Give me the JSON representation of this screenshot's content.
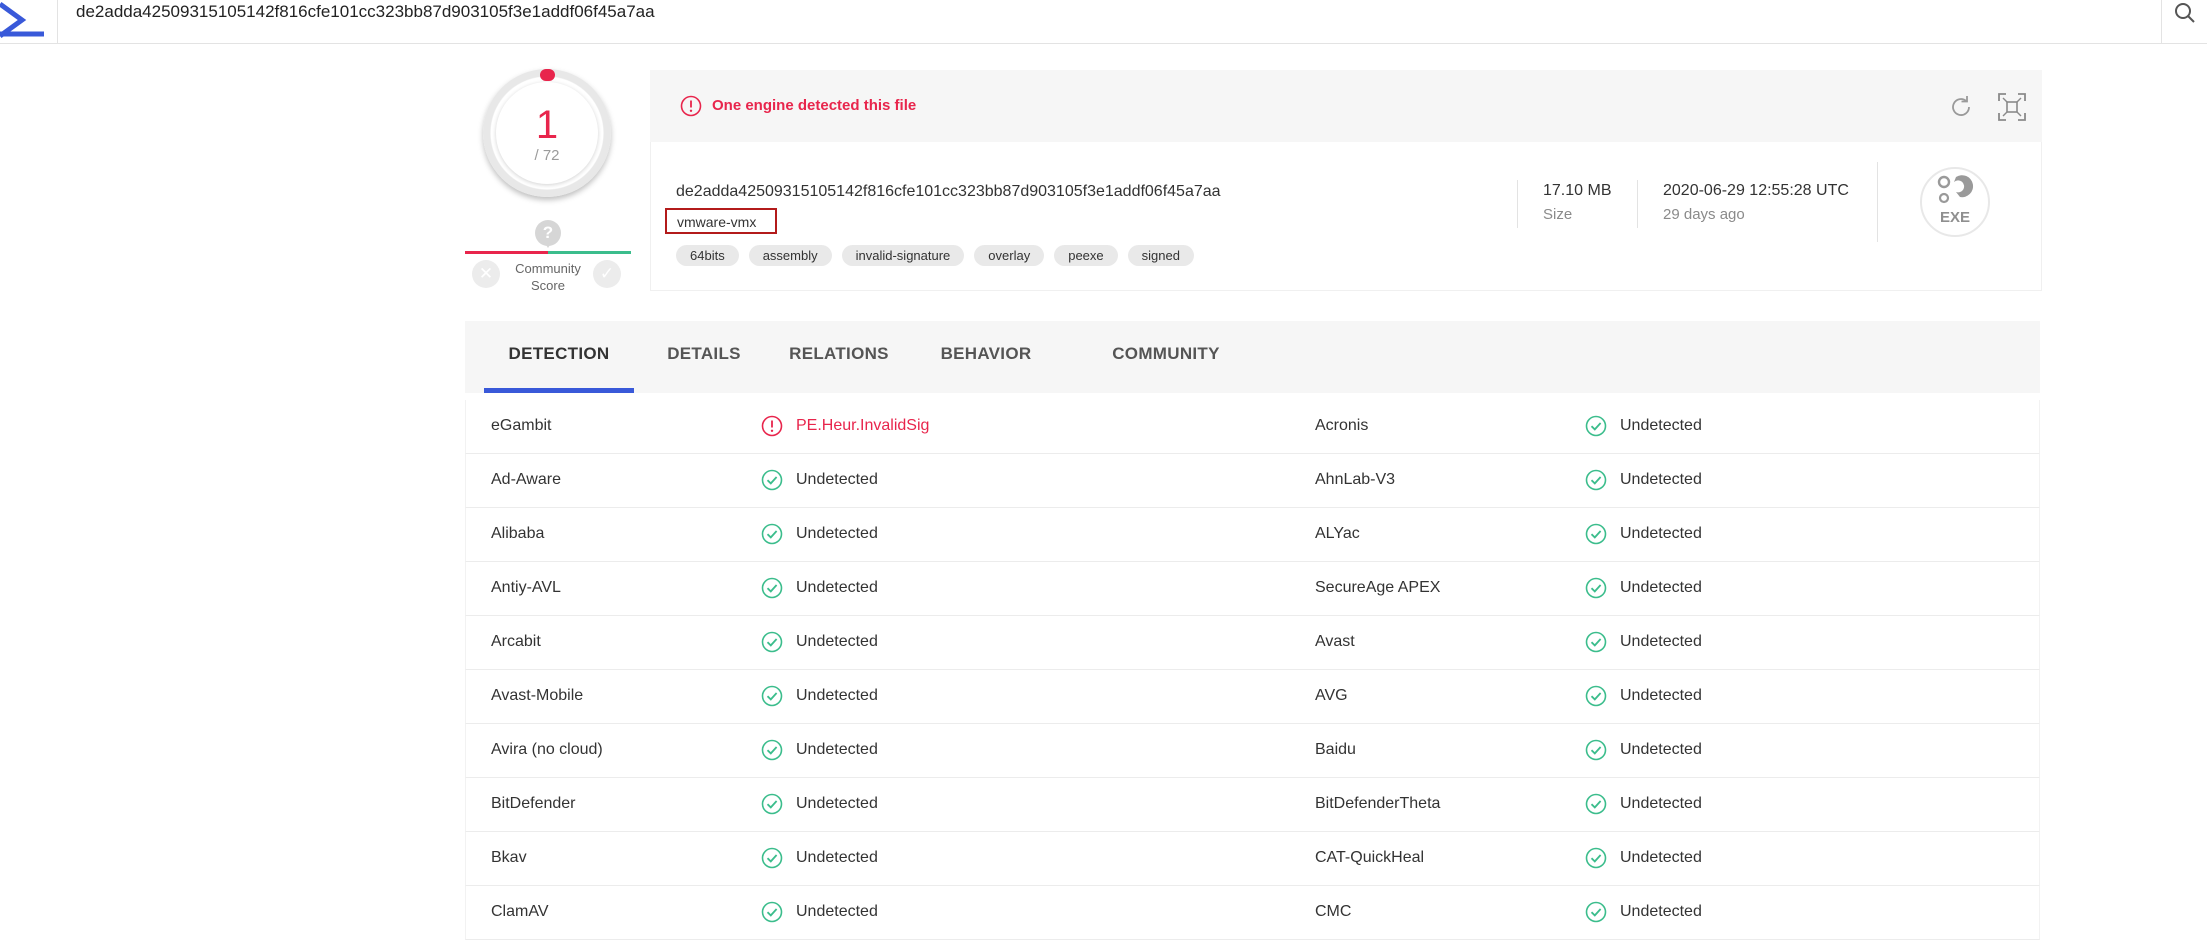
{
  "search": {
    "query": "de2adda42509315105142f816cfe101cc323bb87d903105f3e1addf06f45a7aa"
  },
  "score": {
    "positives": "1",
    "total": "/ 72"
  },
  "community": {
    "question": "?",
    "label_line1": "Community",
    "label_line2": "Score"
  },
  "summary": {
    "alert": "One engine detected this file",
    "hash": "de2adda42509315105142f816cfe101cc323bb87d903105f3e1addf06f45a7aa",
    "file_name": "vmware-vmx",
    "tags": [
      "64bits",
      "assembly",
      "invalid-signature",
      "overlay",
      "peexe",
      "signed"
    ],
    "size_value": "17.10 MB",
    "size_label": "Size",
    "date_value": "2020-06-29 12:55:28 UTC",
    "date_ago": "29 days ago",
    "file_type": "EXE"
  },
  "tabs": [
    "DETECTION",
    "DETAILS",
    "RELATIONS",
    "BEHAVIOR",
    "COMMUNITY"
  ],
  "colors": {
    "accent": "#3959d9",
    "malicious": "#e8254c",
    "clean": "#3bbd8c"
  },
  "detections": [
    {
      "left": {
        "engine": "eGambit",
        "result": "PE.Heur.InvalidSig",
        "malicious": true
      },
      "right": {
        "engine": "Acronis",
        "result": "Undetected",
        "malicious": false
      }
    },
    {
      "left": {
        "engine": "Ad-Aware",
        "result": "Undetected",
        "malicious": false
      },
      "right": {
        "engine": "AhnLab-V3",
        "result": "Undetected",
        "malicious": false
      }
    },
    {
      "left": {
        "engine": "Alibaba",
        "result": "Undetected",
        "malicious": false
      },
      "right": {
        "engine": "ALYac",
        "result": "Undetected",
        "malicious": false
      }
    },
    {
      "left": {
        "engine": "Antiy-AVL",
        "result": "Undetected",
        "malicious": false
      },
      "right": {
        "engine": "SecureAge APEX",
        "result": "Undetected",
        "malicious": false
      }
    },
    {
      "left": {
        "engine": "Arcabit",
        "result": "Undetected",
        "malicious": false
      },
      "right": {
        "engine": "Avast",
        "result": "Undetected",
        "malicious": false
      }
    },
    {
      "left": {
        "engine": "Avast-Mobile",
        "result": "Undetected",
        "malicious": false
      },
      "right": {
        "engine": "AVG",
        "result": "Undetected",
        "malicious": false
      }
    },
    {
      "left": {
        "engine": "Avira (no cloud)",
        "result": "Undetected",
        "malicious": false
      },
      "right": {
        "engine": "Baidu",
        "result": "Undetected",
        "malicious": false
      }
    },
    {
      "left": {
        "engine": "BitDefender",
        "result": "Undetected",
        "malicious": false
      },
      "right": {
        "engine": "BitDefenderTheta",
        "result": "Undetected",
        "malicious": false
      }
    },
    {
      "left": {
        "engine": "Bkav",
        "result": "Undetected",
        "malicious": false
      },
      "right": {
        "engine": "CAT-QuickHeal",
        "result": "Undetected",
        "malicious": false
      }
    },
    {
      "left": {
        "engine": "ClamAV",
        "result": "Undetected",
        "malicious": false
      },
      "right": {
        "engine": "CMC",
        "result": "Undetected",
        "malicious": false
      }
    }
  ]
}
